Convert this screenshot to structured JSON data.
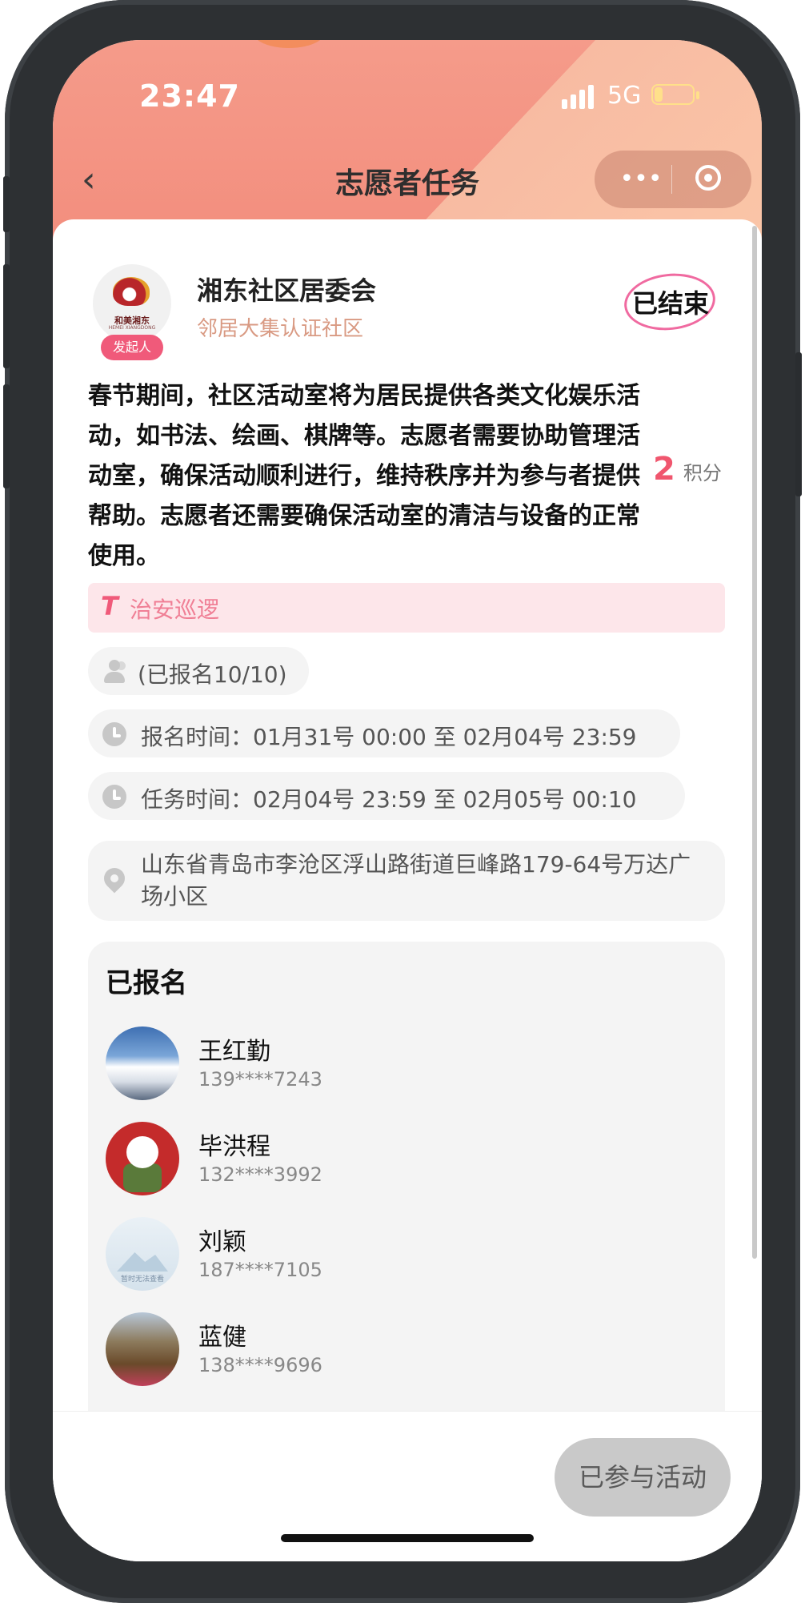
{
  "status_bar": {
    "time": "23:47",
    "network": "5G"
  },
  "nav": {
    "title": "志愿者任务",
    "back_icon": "chevron-left-icon",
    "more_icon": "more-dots-icon",
    "close_icon": "target-circle-icon"
  },
  "organizer": {
    "name": "湘东社区居委会",
    "subtitle": "邻居大集认证社区",
    "role_badge": "发起人",
    "logo_text": "和美湘东",
    "logo_subtext": "HEMEI XIANGDONG"
  },
  "task": {
    "status": "已结束",
    "description": "春节期间，社区活动室将为居民提供各类文化娱乐活动，如书法、绘画、棋牌等。志愿者需要协助管理活动室，确保活动顺利进行，维持秩序并为参与者提供帮助。志愿者还需要确保活动室的清洁与设备的正常使用。",
    "points_value": "2",
    "points_unit": "积分",
    "tag_icon": "T",
    "tag": "治安巡逻",
    "signup_count": "(已报名10/10)",
    "signup_time": "报名时间：01月31号 00:00 至 02月04号 23:59",
    "task_time": "任务时间：02月04号 23:59 至 02月05号 00:10",
    "location": "山东省青岛市李沧区浮山路街道巨峰路179-64号万达广场小区"
  },
  "signed_up": {
    "title": "已报名",
    "people": [
      {
        "name": "王红勤",
        "phone": "139****7243"
      },
      {
        "name": "毕洪程",
        "phone": "132****3992"
      },
      {
        "name": "刘颖",
        "phone": "187****7105",
        "avatar_caption": "暂时无法查看"
      },
      {
        "name": "蓝健",
        "phone": "138****9696"
      }
    ]
  },
  "footer": {
    "joined_label": "已参与活动"
  },
  "colors": {
    "accent_pink": "#f0566e",
    "header_coral": "#f28a7a",
    "header_peach": "#fbc7a8"
  }
}
